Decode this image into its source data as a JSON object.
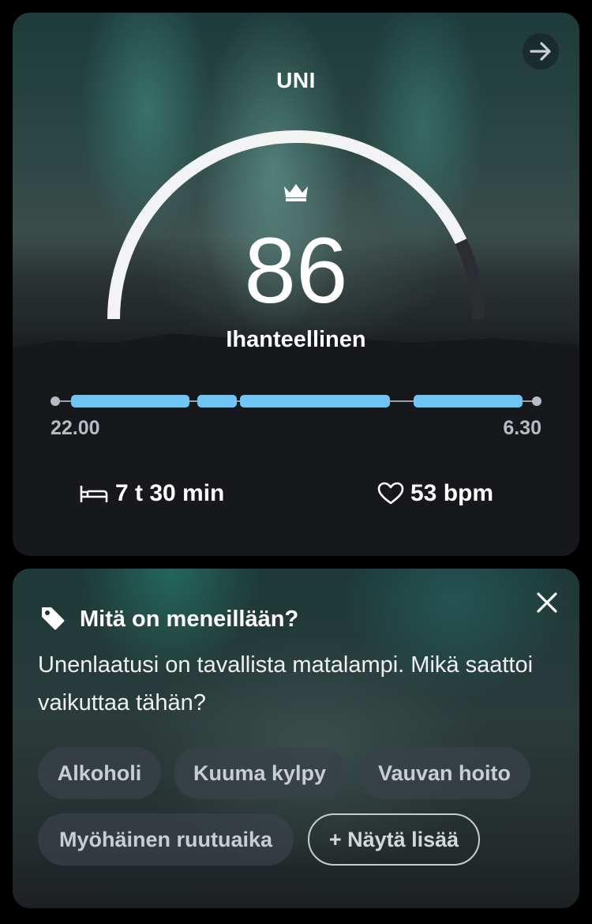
{
  "sleep_card": {
    "title": "UNI",
    "score": "86",
    "score_label": "Ihanteellinen",
    "score_fraction": 0.86,
    "timeline_start": "22.00",
    "timeline_end": "6.30",
    "duration": "7 t 30 min",
    "heart_rate": "53 bpm"
  },
  "info_card": {
    "title": "Mitä on meneillään?",
    "text": "Unenlaatusi on tavallista matalampi. Mikä saattoi vaikuttaa tähän?",
    "chips": [
      "Alkoholi",
      "Kuuma kylpy",
      "Vauvan hoito",
      "Myöhäinen ruutuaika"
    ],
    "show_more": "+ Näytä lisää"
  },
  "colors": {
    "accent_blue": "#6ec6f5",
    "gauge_track": "#2a2e33",
    "gauge_fill": "#f2f3f5"
  },
  "icons": [
    "arrow-right-icon",
    "crown-icon",
    "bed-icon",
    "heart-icon",
    "tag-icon",
    "close-icon"
  ]
}
